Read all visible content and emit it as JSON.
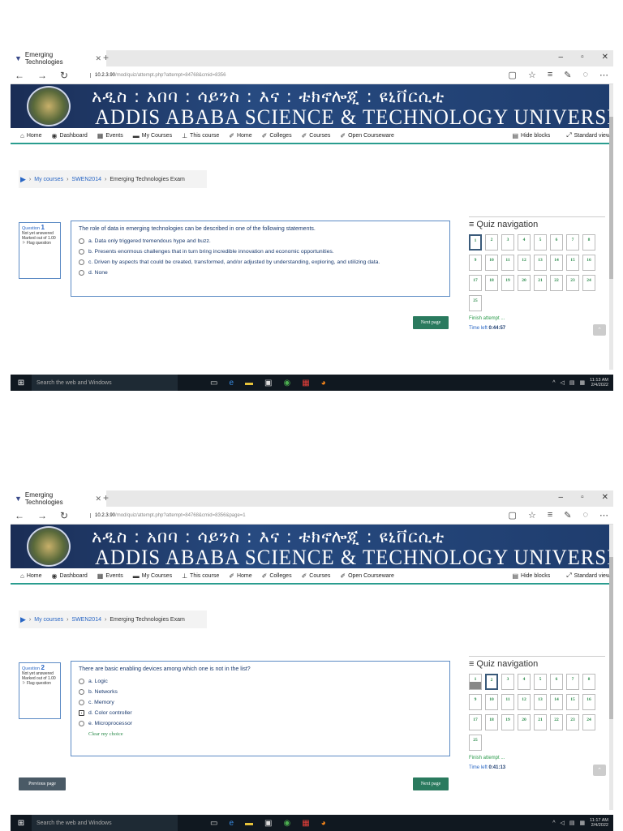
{
  "shared": {
    "tab_title": "Emerging Technologies",
    "banner_amharic": "አዲስ : አበባ : ሳይንስ : እና : ቴክኖሎጂ : ዩኒቨርሲቲ",
    "banner_english": "ADDIS ABABA SCIENCE & TECHNOLOGY UNIVERSITY",
    "menu": [
      "Home",
      "Dashboard",
      "Events",
      "My Courses",
      "This course",
      "Home",
      "Colleges",
      "Courses",
      "Open Courseware"
    ],
    "hide_blocks": "Hide blocks",
    "standard_view": "Standard view",
    "breadcrumb": [
      "My courses",
      "SWEN2014",
      "Emerging Technologies Exam"
    ],
    "quiz_nav_title": "Quiz navigation",
    "finish_attempt": "Finish attempt ...",
    "time_left_label": "Time left",
    "next_page": "Next page",
    "previous_page": "Previous page",
    "clear_choice": "Clear my choice",
    "search_placeholder": "Search the web and Windows",
    "question_status": "Not yet answered",
    "marked_out_of": "Marked out of 1.00",
    "flag_question": "Flag question",
    "question_word": "Question",
    "url_host": "10.2.3.90"
  },
  "screen1": {
    "url_path": "/mod/quiz/attempt.php?attempt=84768&cmid=8356",
    "question_number": "1",
    "question_text": "The role of data in emerging technologies can be described in one of the following statements.",
    "options": [
      "a. Data only triggered tremendous hype and buzz.",
      "b. Presents enormous challenges that in turn bring incredible innovation and economic opportunities.",
      "c. Driven by aspects that could be created, transformed, and/or adjusted by understanding, exploring, and utilizing data.",
      "d. None"
    ],
    "time_left": "0:44:57",
    "clock_time": "11:13 AM",
    "clock_date": "2/4/2022"
  },
  "screen2": {
    "url_path": "/mod/quiz/attempt.php?attempt=84768&cmid=8356&page=1",
    "question_number": "2",
    "question_text": "There are basic enabling devices among which one is not in the list?",
    "options": [
      "a. Logic",
      "b. Networks",
      "c. Memory",
      "d. Color controller",
      "e. Microprocessor"
    ],
    "selected_option": "d. Color controller",
    "time_left": "0:41:13",
    "clock_time": "11:17 AM",
    "clock_date": "2/4/2022"
  },
  "quiz_numbers": [
    "1",
    "2",
    "3",
    "4",
    "5",
    "6",
    "7",
    "8",
    "9",
    "10",
    "11",
    "12",
    "13",
    "14",
    "15",
    "16",
    "17",
    "18",
    "19",
    "20",
    "21",
    "22",
    "23",
    "24",
    "25"
  ]
}
